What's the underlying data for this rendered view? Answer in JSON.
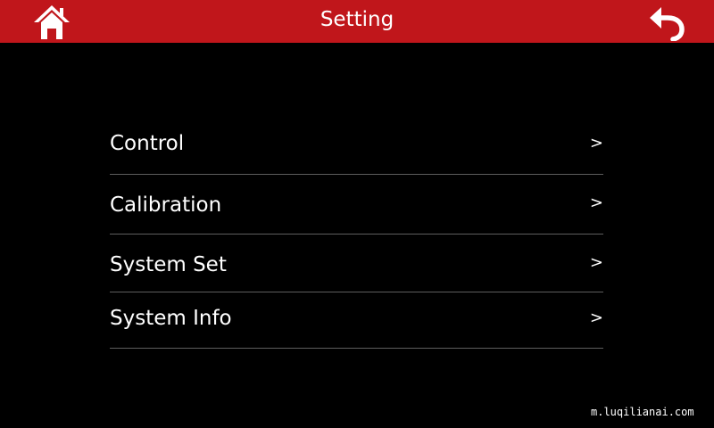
{
  "header": {
    "title": "Setting",
    "home_icon": "home-icon",
    "back_icon": "back-arrow-icon",
    "background_color": "#c0161b"
  },
  "menu": {
    "items": [
      {
        "label": "Control",
        "arrow": ">"
      },
      {
        "label": "Calibration",
        "arrow": ">"
      },
      {
        "label": "System Set",
        "arrow": ">"
      },
      {
        "label": "System Info",
        "arrow": ">"
      }
    ]
  },
  "watermark": "m.luqilianai.com"
}
